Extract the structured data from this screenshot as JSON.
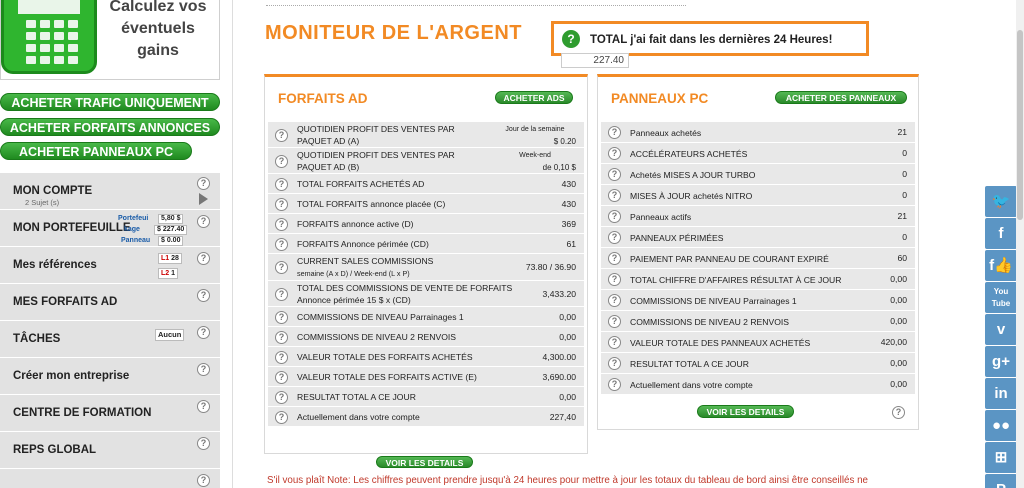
{
  "promo": {
    "text_line1": "Calculez vos",
    "text_line2": "éventuels",
    "text_line3": "gains"
  },
  "buy_buttons": [
    "ACHETER TRAFIC UNIQUEMENT",
    "ACHETER FORFAITS ANNONCES",
    "ACHETER PANNEAUX PC"
  ],
  "menu": [
    {
      "label": "MON COMPTE",
      "sub": "2 Sujet (s)"
    },
    {
      "label": "MON PORTEFEUILLE"
    },
    {
      "label": "Mes références"
    },
    {
      "label": "MES FORFAITS AD"
    },
    {
      "label": "TÂCHES",
      "badge": "Aucun"
    },
    {
      "label": "Créer mon entreprise"
    },
    {
      "label": "CENTRE DE FORMATION"
    },
    {
      "label": "REPS GLOBAL"
    }
  ],
  "wallet": {
    "portefeuille_label": "Portefeui",
    "portefeuille_value": "5,80 $",
    "package_label": "kage",
    "package_value": "$ 227.40",
    "panneau_label": "Panneau",
    "panneau_value": "$ 0.00"
  },
  "refs": {
    "l1_label": "L1",
    "l1_value": "28",
    "l2_label": "L2",
    "l2_value": "1"
  },
  "page_title": "MONITEUR DE L'ARGENT",
  "total_box": {
    "text": "TOTAL j'ai fait dans les dernières 24 Heures!",
    "value": "227.40"
  },
  "forfaits": {
    "title": "FORFAITS AD",
    "button": "ACHETER ADS",
    "bottom_button": "VOIR LES DETAILS",
    "rows": [
      {
        "label": "QUOTIDIEN PROFIT DES VENTES PAR PAQUET AD (A)",
        "mid": "Jour de la semaine",
        "value": "$ 0.20"
      },
      {
        "label": "QUOTIDIEN PROFIT DES VENTES PAR PAQUET AD (B)",
        "mid": "Week-end",
        "value": "de 0,10 $"
      },
      {
        "label": "TOTAL FORFAITS ACHETÉS AD",
        "value": "430"
      },
      {
        "label": "TOTAL FORFAITS annonce placée (C)",
        "value": "430"
      },
      {
        "label": "FORFAITS annonce active (D)",
        "value": "369"
      },
      {
        "label": "FORFAITS Annonce périmée (CD)",
        "value": "61"
      },
      {
        "label": "CURRENT SALES COMMISSIONS",
        "sub": "semaine (A x D) / Week-end (L x P)",
        "value": "73.80 / 36.90"
      },
      {
        "label": "TOTAL DES COMMISSIONS DE VENTE DE FORFAITS Annonce périmée 15 $ x (CD)",
        "value": "3,433.20"
      },
      {
        "label": "COMMISSIONS DE NIVEAU Parrainages 1",
        "value": "0,00"
      },
      {
        "label": "COMMISSIONS DE NIVEAU 2 RENVOIS",
        "value": "0,00"
      },
      {
        "label": "VALEUR TOTALE DES FORFAITS ACHETÉS",
        "value": "4,300.00"
      },
      {
        "label": "VALEUR TOTALE DES FORFAITS ACTIVE (E)",
        "value": "3,690.00"
      },
      {
        "label": "RESULTAT TOTAL A CE JOUR",
        "value": "0,00"
      },
      {
        "label": "Actuellement dans votre compte",
        "value": "227,40"
      }
    ]
  },
  "panneaux": {
    "title": "PANNEAUX PC",
    "button": "ACHETER DES PANNEAUX",
    "bottom_button": "VOIR LES DETAILS",
    "rows": [
      {
        "label": "Panneaux achetés",
        "value": "21"
      },
      {
        "label": "ACCÉLÉRATEURS ACHETÉS",
        "value": "0"
      },
      {
        "label": "Achetés MISES A JOUR TURBO",
        "value": "0"
      },
      {
        "label": "MISES À JOUR achetés NITRO",
        "value": "0"
      },
      {
        "label": "Panneaux actifs",
        "value": "21"
      },
      {
        "label": "PANNEAUX PÉRIMÉES",
        "value": "0"
      },
      {
        "label": "PAIEMENT PAR PANNEAU DE COURANT EXPIRÉ",
        "value": "60"
      },
      {
        "label": "TOTAL CHIFFRE D'AFFAIRES RÉSULTAT À CE JOUR",
        "value": "0,00"
      },
      {
        "label": "COMMISSIONS DE NIVEAU Parrainages 1",
        "value": "0,00"
      },
      {
        "label": "COMMISSIONS DE NIVEAU 2 RENVOIS",
        "value": "0,00"
      },
      {
        "label": "VALEUR TOTALE DES PANNEAUX ACHETÉS",
        "value": "420,00"
      },
      {
        "label": "RESULTAT TOTAL A CE JOUR",
        "value": "0,00"
      },
      {
        "label": "Actuellement dans votre compte",
        "value": "0,00"
      }
    ]
  },
  "note": "S'il vous plaît Note: Les chiffres peuvent prendre jusqu'à 24 heures pour mettre à jour les totaux du tableau de bord ainsi être conseillés ne",
  "social": [
    "twitter",
    "facebook",
    "facebook-like",
    "youtube",
    "vimeo",
    "google-plus",
    "linkedin",
    "flickr",
    "windows",
    "pinterest"
  ],
  "social_glyphs": [
    "🐦",
    "f",
    "f👍",
    "You Tube",
    "v",
    "g+",
    "in",
    "●●",
    "⊞",
    "P"
  ],
  "colors": {
    "accent": "#f28a24",
    "button_green": "#2a8a2a",
    "social": "#5b95c4"
  }
}
